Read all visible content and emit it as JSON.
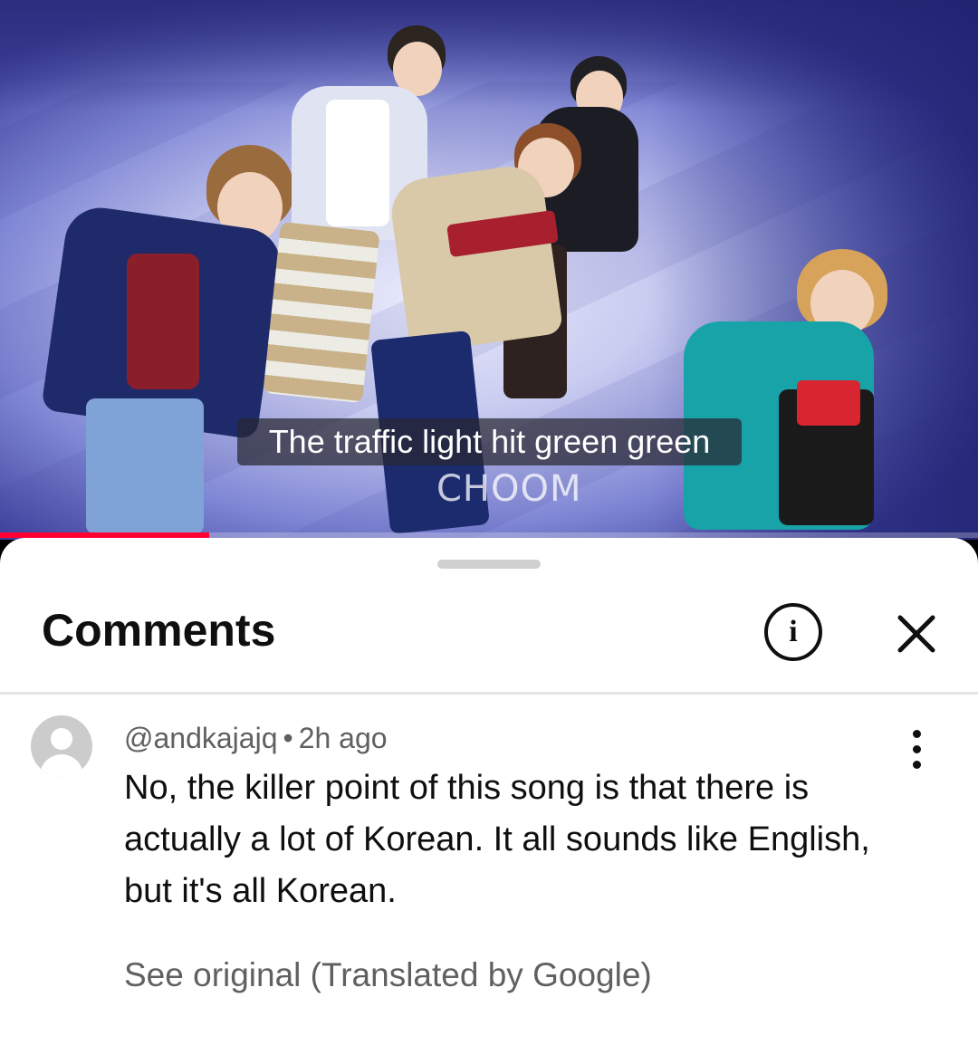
{
  "video": {
    "subtitle": "The traffic light hit green green",
    "watermark": "CHOOM",
    "progress_percent": 21.4,
    "progress_color": "#ff0033"
  },
  "comments_panel": {
    "title": "Comments",
    "info_icon": "info-icon",
    "close_icon": "close-icon",
    "comment": {
      "avatar_icon": "default-avatar-icon",
      "author": "@andkajajq",
      "separator": "•",
      "time": "2h ago",
      "text": "No, the killer point of this song is that there is actually a lot of Korean. It all sounds like English, but it's all Korean.",
      "translation_link": "See original (Translated by Google)",
      "more_icon": "more-vertical-icon"
    }
  }
}
